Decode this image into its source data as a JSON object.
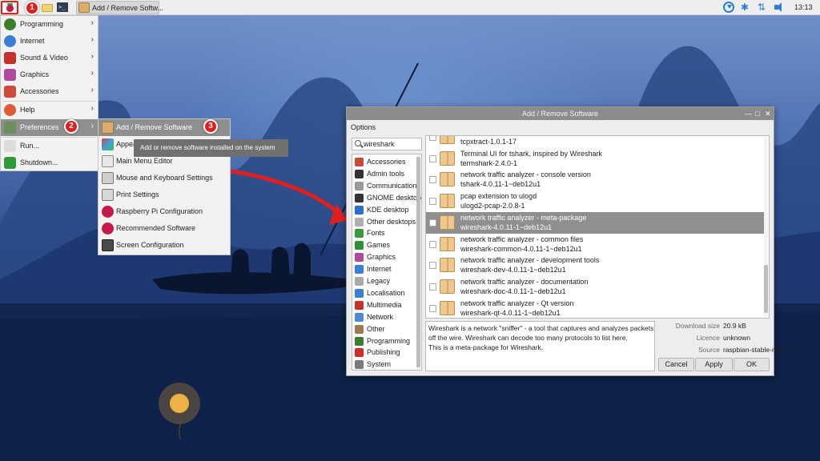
{
  "taskbar": {
    "task_title": "Add / Remove Softw...",
    "clock": "13:13",
    "terminal_glyph": ">_"
  },
  "badges": {
    "b1": "1",
    "b2": "2",
    "b3": "3"
  },
  "main_menu": {
    "items": [
      {
        "label": "Programming",
        "icon": "programming-icon",
        "color": "#3a7d2c"
      },
      {
        "label": "Internet",
        "icon": "globe-icon",
        "color": "#3b7ed6"
      },
      {
        "label": "Sound & Video",
        "icon": "film-icon",
        "color": "#c8302c"
      },
      {
        "label": "Graphics",
        "icon": "paint-icon",
        "color": "#b04aa0"
      },
      {
        "label": "Accessories",
        "icon": "tools-icon",
        "color": "#d04a3a"
      },
      {
        "label": "Help",
        "icon": "lifebuoy-icon",
        "color": "#e05a3a"
      },
      {
        "label": "Preferences",
        "icon": "preferences-icon",
        "color": "#6b8f5a"
      },
      {
        "label": "Run...",
        "icon": "run-icon",
        "color": "#7a7a7a"
      },
      {
        "label": "Shutdown...",
        "icon": "shutdown-icon",
        "color": "#2f9a3a"
      }
    ]
  },
  "pref_menu": {
    "items": [
      {
        "label": "Add / Remove Software",
        "icon": "package-icon"
      },
      {
        "label": "Appea",
        "icon": "appearance-icon"
      },
      {
        "label": "Main Menu Editor",
        "icon": "menu-editor-icon"
      },
      {
        "label": "Mouse and Keyboard Settings",
        "icon": "keyboard-icon"
      },
      {
        "label": "Print Settings",
        "icon": "printer-icon"
      },
      {
        "label": "Raspberry Pi Configuration",
        "icon": "raspberry-icon"
      },
      {
        "label": "Recommended Software",
        "icon": "raspberry-icon"
      },
      {
        "label": "Screen Configuration",
        "icon": "monitor-icon"
      }
    ]
  },
  "tooltip": "Add or remove software installed on the system",
  "window": {
    "title": "Add / Remove Software",
    "menu": "Options",
    "search_value": "wireshark",
    "categories": [
      {
        "label": "Accessories",
        "icon": "tools-icon",
        "color": "#c84a3a"
      },
      {
        "label": "Admin tools",
        "icon": "admin-icon",
        "color": "#333333"
      },
      {
        "label": "Communication",
        "icon": "communication-icon",
        "color": "#9a9a9a"
      },
      {
        "label": "GNOME desktop",
        "icon": "gnome-icon",
        "color": "#333333"
      },
      {
        "label": "KDE desktop",
        "icon": "kde-icon",
        "color": "#2a6fd0"
      },
      {
        "label": "Other desktops",
        "icon": "desktop-icon",
        "color": "#b0b0b0"
      },
      {
        "label": "Fonts",
        "icon": "fonts-icon",
        "color": "#3a9a3a"
      },
      {
        "label": "Games",
        "icon": "games-icon",
        "color": "#2f8f3a"
      },
      {
        "label": "Graphics",
        "icon": "paint-icon",
        "color": "#b04aa0"
      },
      {
        "label": "Internet",
        "icon": "globe-icon",
        "color": "#3b7ed6"
      },
      {
        "label": "Legacy",
        "icon": "legacy-icon",
        "color": "#aaaaaa"
      },
      {
        "label": "Localisation",
        "icon": "globe-icon",
        "color": "#3b7ed6"
      },
      {
        "label": "Multimedia",
        "icon": "film-icon",
        "color": "#c8302c"
      },
      {
        "label": "Network",
        "icon": "network-icon",
        "color": "#4a8ad8"
      },
      {
        "label": "Other",
        "icon": "folder-icon",
        "color": "#a07850"
      },
      {
        "label": "Programming",
        "icon": "programming-icon",
        "color": "#3a7d2c"
      },
      {
        "label": "Publishing",
        "icon": "publishing-icon",
        "color": "#d02a2a"
      },
      {
        "label": "System",
        "icon": "system-icon",
        "color": "#7a7a7a"
      }
    ],
    "packages": [
      {
        "summary": "",
        "name": "tcpxtract-1.0.1-17",
        "selected": false
      },
      {
        "summary": "Terminal UI for tshark, inspired by Wireshark",
        "name": "termshark-2.4.0-1",
        "selected": false
      },
      {
        "summary": "network traffic analyzer - console version",
        "name": "tshark-4.0.11-1~deb12u1",
        "selected": false
      },
      {
        "summary": "pcap extension to ulogd",
        "name": "ulogd2-pcap-2.0.8-1",
        "selected": false
      },
      {
        "summary": "network traffic analyzer - meta-package",
        "name": "wireshark-4.0.11-1~deb12u1",
        "selected": true
      },
      {
        "summary": "network traffic analyzer - common files",
        "name": "wireshark-common-4.0.11-1~deb12u1",
        "selected": false
      },
      {
        "summary": "network traffic analyzer - development tools",
        "name": "wireshark-dev-4.0.11-1~deb12u1",
        "selected": false
      },
      {
        "summary": "network traffic analyzer - documentation",
        "name": "wireshark-doc-4.0.11-1~deb12u1",
        "selected": false
      },
      {
        "summary": "network traffic analyzer - Qt version",
        "name": "wireshark-qt-4.0.11-1~deb12u1",
        "selected": false
      }
    ],
    "description": [
      "Wireshark is a network \"sniffer\" - a tool that captures and analyzes packets",
      "off the wire. Wireshark can decode too many protocols to list here.",
      "This is a meta-package for Wireshark."
    ],
    "info": {
      "download_size_label": "Download size",
      "download_size": "20.9 kB",
      "licence_label": "Licence",
      "licence": "unknown",
      "source_label": "Source",
      "source": "raspbian-stable-main"
    },
    "buttons": {
      "cancel": "Cancel",
      "apply": "Apply",
      "ok": "OK"
    }
  }
}
